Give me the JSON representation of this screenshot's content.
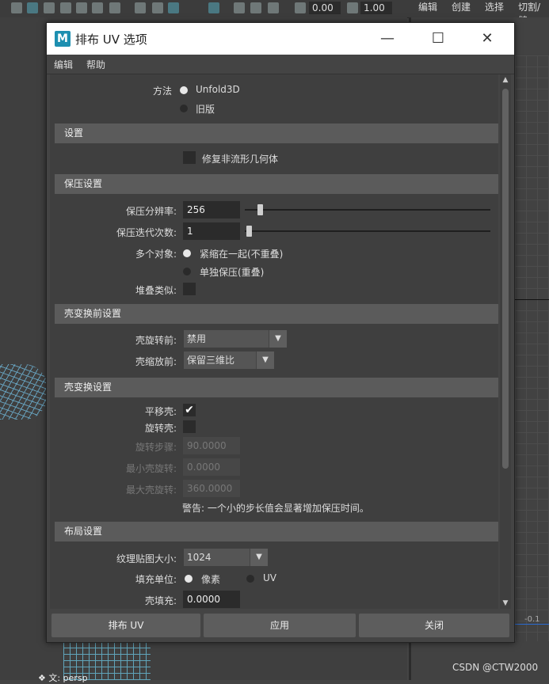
{
  "bg": {
    "toolbar_value1": "0.00",
    "toolbar_value2": "1.00",
    "menu": [
      "编辑",
      "创建",
      "选择",
      "切割/缝"
    ],
    "persp_label": "❖ 文: persp",
    "right_value": "-0.1",
    "watermark": "CSDN @CTW2000"
  },
  "dialog": {
    "title": "排布 UV 选项",
    "logo": "M",
    "minimize": "—",
    "maximize": "☐",
    "close": "✕",
    "menu": {
      "edit": "编辑",
      "help": "帮助"
    },
    "method": {
      "label": "方法",
      "opt1": "Unfold3D",
      "opt2": "旧版"
    },
    "settings": {
      "header": "设置",
      "fix_nonmanifold": "修复非流形几何体"
    },
    "pack": {
      "header": "保压设置",
      "resolution_label": "保压分辨率:",
      "resolution_value": "256",
      "iterations_label": "保压迭代次数:",
      "iterations_value": "1",
      "multi_label": "多个对象:",
      "multi_opt1": "紧缩在一起(不重叠)",
      "multi_opt2": "单独保压(重叠)",
      "stack_label": "堆叠类似:"
    },
    "shell_pre": {
      "header": "壳变换前设置",
      "rotate_label": "壳旋转前:",
      "rotate_value": "禁用",
      "scale_label": "壳缩放前:",
      "scale_value": "保留三维比"
    },
    "shell_xform": {
      "header": "壳变换设置",
      "translate_label": "平移壳:",
      "rotate_label": "旋转壳:",
      "step_label": "旋转步骤:",
      "step_value": "90.0000",
      "min_label": "最小壳旋转:",
      "min_value": "0.0000",
      "max_label": "最大壳旋转:",
      "max_value": "360.0000",
      "warning": "警告: 一个小的步长值会显著增加保压时间。"
    },
    "layout": {
      "header": "布局设置",
      "tex_label": "纹理贴图大小:",
      "tex_value": "1024",
      "fill_label": "填充单位:",
      "fill_opt1": "像素",
      "fill_opt2": "UV",
      "shell_pad_label": "壳填充:",
      "shell_pad_value": "0.0000"
    },
    "buttons": {
      "layout": "排布 UV",
      "apply": "应用",
      "close": "关闭"
    }
  }
}
